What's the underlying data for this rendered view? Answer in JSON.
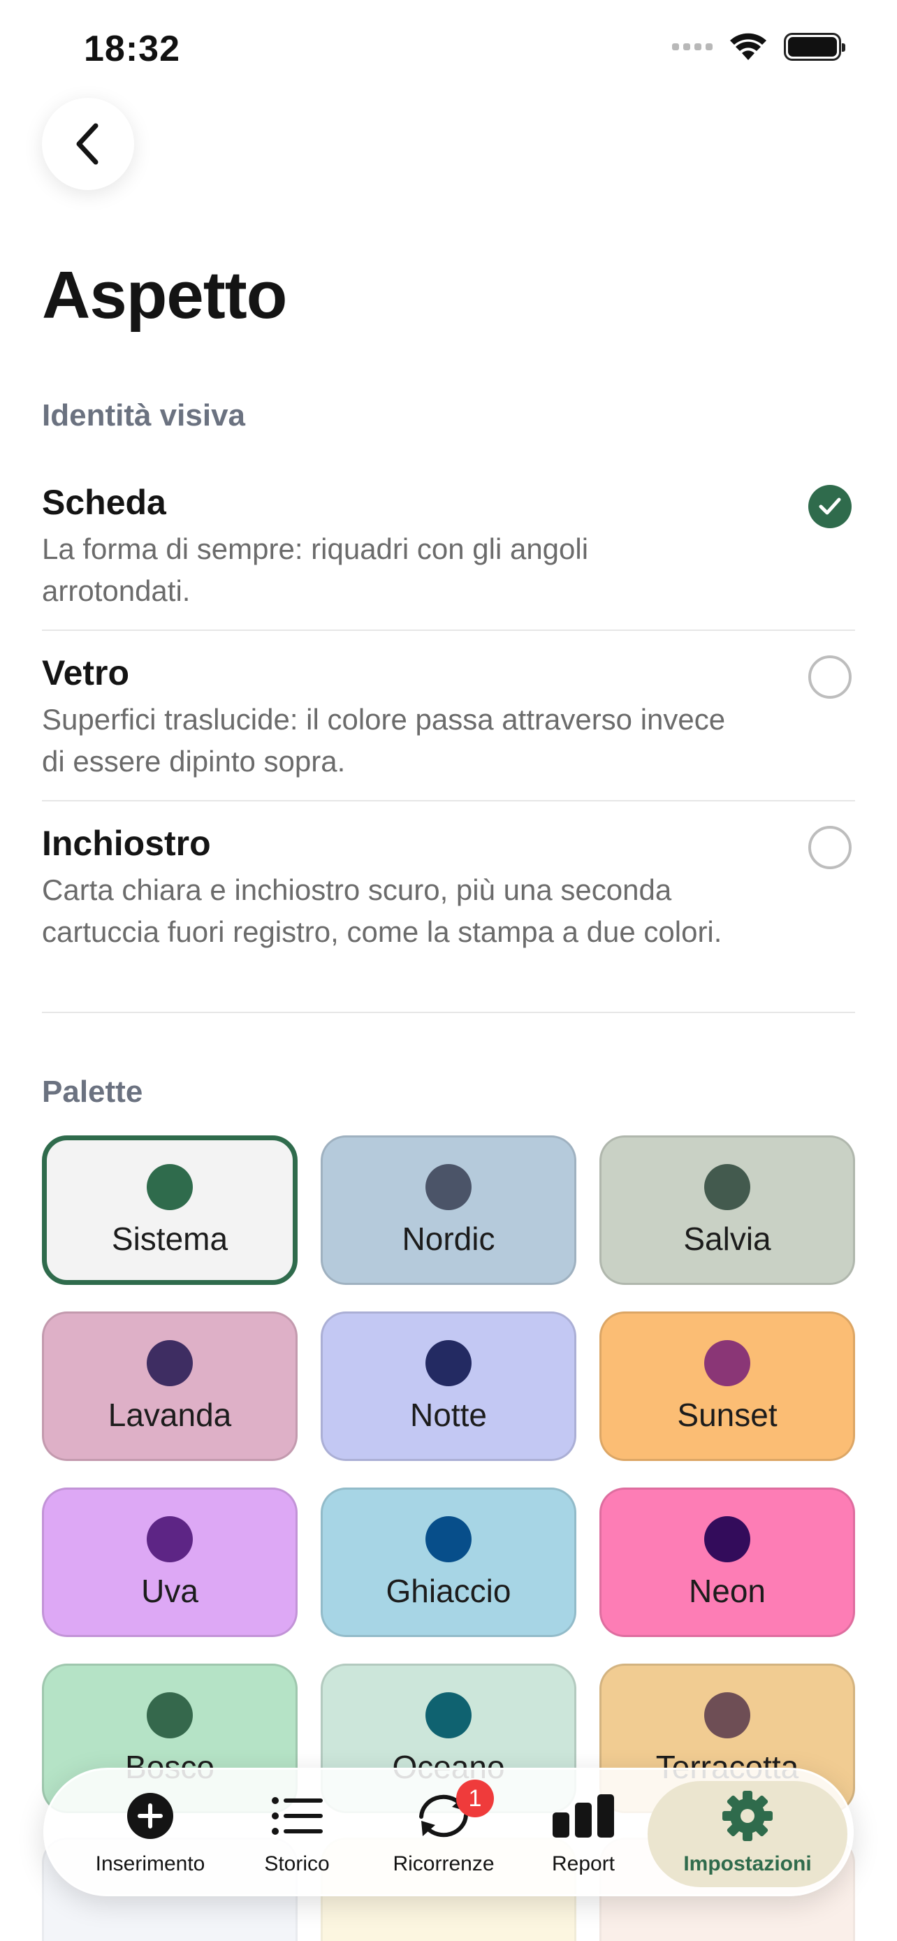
{
  "status_bar": {
    "time": "18:32"
  },
  "page": {
    "title": "Aspetto"
  },
  "identity": {
    "section_label": "Identità visiva",
    "options": [
      {
        "title": "Scheda",
        "description": "La forma di sempre: riquadri con gli angoli arrotondati.",
        "selected": true
      },
      {
        "title": "Vetro",
        "description": "Superfici traslucide: il colore passa attraverso invece di essere dipinto sopra.",
        "selected": false
      },
      {
        "title": "Inchiostro",
        "description": "Carta chiara e inchiostro scuro, più una seconda cartuccia fuori registro, come la stampa a due colori.",
        "selected": false
      }
    ]
  },
  "palette": {
    "section_label": "Palette",
    "items": [
      {
        "name": "Sistema",
        "bg": "#f3f3f3",
        "dot": "#2f6b4c",
        "selected": true
      },
      {
        "name": "Nordic",
        "bg": "#b5cadb",
        "dot": "#4b5468",
        "selected": false
      },
      {
        "name": "Salvia",
        "bg": "#c9d1c5",
        "dot": "#435a4e",
        "selected": false
      },
      {
        "name": "Lavanda",
        "bg": "#deb0c7",
        "dot": "#3e2d62",
        "selected": false
      },
      {
        "name": "Notte",
        "bg": "#c3c8f3",
        "dot": "#232a62",
        "selected": false
      },
      {
        "name": "Sunset",
        "bg": "#fbbd74",
        "dot": "#8a3676",
        "selected": false
      },
      {
        "name": "Uva",
        "bg": "#dda8f5",
        "dot": "#5d2585",
        "selected": false
      },
      {
        "name": "Ghiaccio",
        "bg": "#a7d5e5",
        "dot": "#074e8a",
        "selected": false
      },
      {
        "name": "Neon",
        "bg": "#fd7db5",
        "dot": "#330c5b",
        "selected": false
      },
      {
        "name": "Bosco",
        "bg": "#b5e3c6",
        "dot": "#35684c",
        "selected": false
      },
      {
        "name": "Oceano",
        "bg": "#cce6da",
        "dot": "#0f6270",
        "selected": false
      },
      {
        "name": "Terracotta",
        "bg": "#f1cc92",
        "dot": "#6e4e55",
        "selected": false
      }
    ]
  },
  "tab_bar": {
    "tabs": [
      {
        "label": "Inserimento",
        "icon": "plus-circle-icon"
      },
      {
        "label": "Storico",
        "icon": "list-icon"
      },
      {
        "label": "Ricorrenze",
        "icon": "repeat-icon",
        "badge": "1"
      },
      {
        "label": "Report",
        "icon": "bar-chart-icon"
      },
      {
        "label": "Impostazioni",
        "icon": "gear-icon",
        "active": true
      }
    ]
  },
  "colors": {
    "accent": "#2f6b4c",
    "text": "#141414",
    "muted": "#6b6b6b",
    "badge": "#ef3b3b"
  }
}
